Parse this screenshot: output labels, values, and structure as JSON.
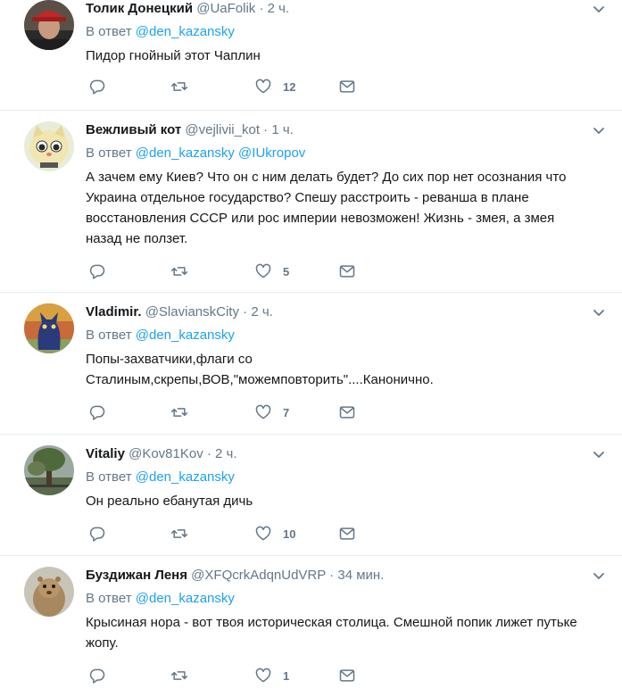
{
  "reply_prefix": "В ответ",
  "tweets": [
    {
      "name": "Толик Донецкий",
      "handle": "@UaFolik",
      "sep": " · ",
      "time": "2 ч.",
      "mentions": [
        "@den_kazansky"
      ],
      "text": "Пидор гнойный этот Чаплин",
      "likes": "12",
      "avatar": "photo-man-in-red-cap"
    },
    {
      "name": "Вежливый кот",
      "handle": "@vejlivii_kot",
      "sep": " · ",
      "time": "1 ч.",
      "mentions": [
        "@den_kazansky",
        "@IUkropov"
      ],
      "text": "А зачем ему Киев? Что он с ним делать будет? До сих пор нет осознания что Украина отдельное государство? Спешу расстроить - реванша в плане восстановления СССР или рос империи невозможен! Жизнь - змея, а змея назад не ползет.",
      "likes": "5",
      "avatar": "cartoon-cat"
    },
    {
      "name": "Vladimir.",
      "handle": "@SlavianskCity",
      "sep": " · ",
      "time": "2 ч.",
      "mentions": [
        "@den_kazansky"
      ],
      "text": "Попы-захватчики,флаги со Сталиным,скрепы,ВОВ,\"можемповторить\"....Канонично.",
      "likes": "7",
      "avatar": "painted-blue-cat"
    },
    {
      "name": "Vitaliy",
      "handle": "@Kov81Kov",
      "sep": " · ",
      "time": "2 ч.",
      "mentions": [
        "@den_kazansky"
      ],
      "text": "Он реально ебанутая дичь",
      "likes": "10",
      "avatar": "photo-tree-park"
    },
    {
      "name": "Буздижан Леня",
      "handle": "@XFQcrkAdqnUdVRP",
      "sep": " · ",
      "time": "34 мин.",
      "mentions": [
        "@den_kazansky"
      ],
      "text": "Крысиная нора - вот твоя историческая столица. Смешной попик лижет путьке жопу.",
      "likes": "1",
      "avatar": "photo-gopher"
    }
  ],
  "icons": {
    "reply": "reply-icon",
    "retweet": "retweet-icon",
    "like": "heart-icon",
    "dm": "envelope-icon",
    "caret": "chevron-down-icon"
  },
  "colors": {
    "accent": "#1da1f2",
    "muted": "#657786",
    "text": "#14171a",
    "divider": "#e6ecf0"
  }
}
